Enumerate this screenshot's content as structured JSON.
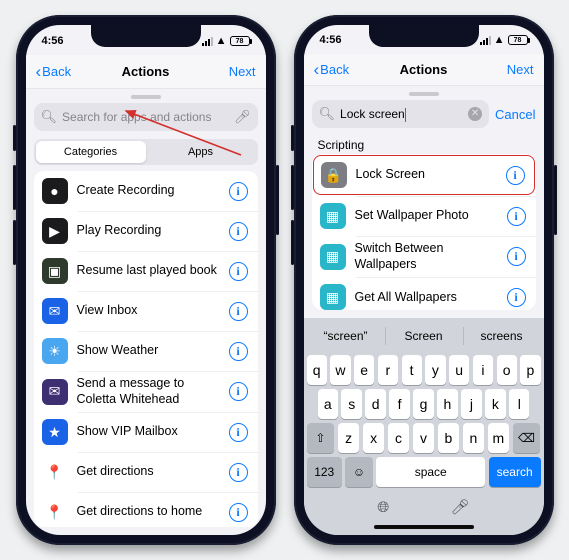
{
  "status": {
    "time": "4:56",
    "battery": "78"
  },
  "nav": {
    "back": "Back",
    "title": "Actions",
    "next": "Next"
  },
  "left": {
    "search_placeholder": "Search for apps and actions",
    "tabs": {
      "categories": "Categories",
      "apps": "Apps"
    },
    "rows": [
      {
        "label": "Create Recording",
        "icon_bg": "#1b1b1d",
        "glyph": "●"
      },
      {
        "label": "Play Recording",
        "icon_bg": "#1b1b1d",
        "glyph": "▶"
      },
      {
        "label": "Resume last played book",
        "icon_bg": "#2e3a2c",
        "glyph": "▣"
      },
      {
        "label": "View Inbox",
        "icon_bg": "#1a63e6",
        "glyph": "✉"
      },
      {
        "label": "Show Weather",
        "icon_bg": "#4aa7ef",
        "glyph": "☀"
      },
      {
        "label": "Send a message to",
        "sub": "Coletta Whitehead",
        "icon_bg": "#3e2e72",
        "glyph": "✉"
      },
      {
        "label": "Show VIP Mailbox",
        "icon_bg": "#1a63e6",
        "glyph": "★"
      },
      {
        "label": "Get directions",
        "icon_bg": "#ffffff",
        "glyph": "📍"
      },
      {
        "label": "Get directions to home",
        "icon_bg": "#ffffff",
        "glyph": "📍"
      }
    ]
  },
  "right": {
    "search_value": "Lock screen",
    "cancel": "Cancel",
    "section": "Scripting",
    "rows": [
      {
        "label": "Lock Screen",
        "icon_bg": "#7d7e83",
        "glyph": "🔒",
        "hl": true
      },
      {
        "label": "Set Wallpaper Photo",
        "icon_bg": "#2ab6c9",
        "glyph": "▦"
      },
      {
        "label": "Switch Between Wallpapers",
        "icon_bg": "#2ab6c9",
        "glyph": "▦"
      },
      {
        "label": "Get All Wallpapers",
        "icon_bg": "#2ab6c9",
        "glyph": "▦"
      }
    ],
    "suggestions": [
      "“screen”",
      "Screen",
      "screens"
    ],
    "keys": {
      "r1": [
        "q",
        "w",
        "e",
        "r",
        "t",
        "y",
        "u",
        "i",
        "o",
        "p"
      ],
      "r2": [
        "a",
        "s",
        "d",
        "f",
        "g",
        "h",
        "j",
        "k",
        "l"
      ],
      "r3": [
        "z",
        "x",
        "c",
        "v",
        "b",
        "n",
        "m"
      ],
      "shift": "⇧",
      "del": "⌫",
      "num": "123",
      "emoji": "☺",
      "space": "space",
      "search": "search"
    }
  }
}
